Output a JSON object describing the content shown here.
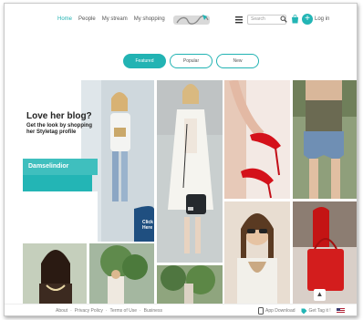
{
  "nav": {
    "items": [
      "Home",
      "People",
      "My stream",
      "My shopping"
    ],
    "active_index": 0
  },
  "search": {
    "placeholder": "Search"
  },
  "login_label": "Log in",
  "add_label": "+",
  "tabs": [
    {
      "label": "Featured",
      "active": true
    },
    {
      "label": "Popular",
      "active": false
    },
    {
      "label": "New",
      "active": false
    }
  ],
  "promo": {
    "heading": "Love her blog?",
    "subheading": "Get the look by shopping her Styletag profile",
    "brand_name": "Damselindior",
    "cta": "Click Here"
  },
  "footer": {
    "links": [
      "About",
      "·",
      "Privacy Policy",
      "·",
      "Terms of Use",
      "·",
      "Business"
    ],
    "app_download": "App Download",
    "get_tag": "Get Tag it !"
  },
  "scroll_top_label": "▲",
  "colors": {
    "accent": "#22b3b3"
  }
}
